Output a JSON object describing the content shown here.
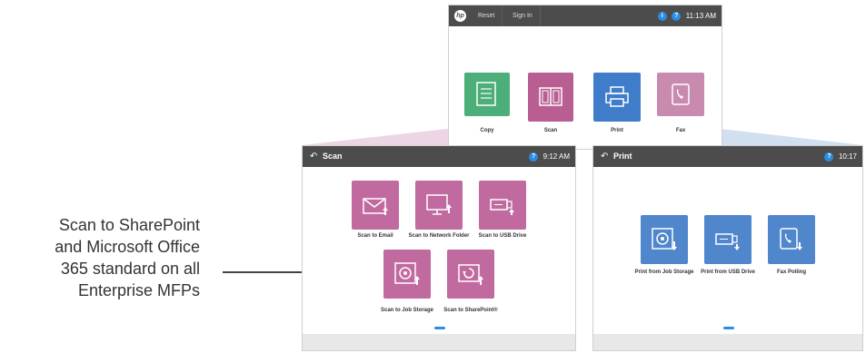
{
  "callout": {
    "line1": "Scan to SharePoint",
    "line2": "and Microsoft Office",
    "line3": "365 standard on all",
    "line4": "Enterprise MFPs"
  },
  "home": {
    "logo": "hp",
    "tabs": [
      "Reset",
      "Sign In"
    ],
    "time": "11:13 AM",
    "tiles": [
      {
        "label": "Copy",
        "color": "#4cae78",
        "icon": "document-icon"
      },
      {
        "label": "Scan",
        "color": "#b85e93",
        "icon": "book-icon"
      },
      {
        "label": "Print",
        "color": "#3f7cc9",
        "icon": "printer-icon"
      },
      {
        "label": "Fax",
        "color": "#c98ab0",
        "icon": "phone-icon"
      }
    ]
  },
  "scan": {
    "title": "Scan",
    "time": "9:12 AM",
    "tiles": [
      {
        "label": "Scan to Email",
        "icon": "envelope-icon"
      },
      {
        "label": "Scan to Network Folder",
        "icon": "monitor-icon"
      },
      {
        "label": "Scan to USB Drive",
        "icon": "usb-icon"
      },
      {
        "label": "Scan to Job Storage",
        "icon": "disk-icon"
      },
      {
        "label": "Scan to SharePoint®",
        "icon": "sharepoint-icon"
      }
    ]
  },
  "print": {
    "title": "Print",
    "time": "10:17",
    "tiles": [
      {
        "label": "Print from Job Storage",
        "icon": "disk-icon"
      },
      {
        "label": "Print from USB Drive",
        "icon": "usb-icon"
      },
      {
        "label": "Fax Polling",
        "icon": "phone-icon"
      }
    ]
  },
  "colors": {
    "scan_tile": "#c06aa0",
    "print_tile": "#4f86cc",
    "accent": "#2b8de1",
    "topbar": "#4c4c4c"
  }
}
